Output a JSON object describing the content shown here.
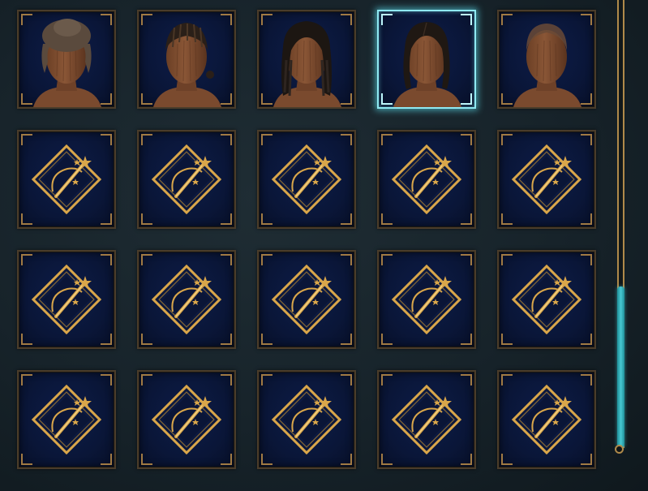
{
  "grid": {
    "columns": 5,
    "selected_index": 3,
    "items": [
      {
        "kind": "hairstyle",
        "icon": "hairstyle-bun-icon",
        "hair": "bun",
        "hair_color": "#5a4a3d"
      },
      {
        "kind": "hairstyle",
        "icon": "hairstyle-cornrows-icon",
        "hair": "cornrows",
        "hair_color": "#2a1f18"
      },
      {
        "kind": "hairstyle",
        "icon": "hairstyle-locs-icon",
        "hair": "locs",
        "hair_color": "#1c1612"
      },
      {
        "kind": "hairstyle",
        "icon": "hairstyle-long-parted-icon",
        "hair": "long",
        "hair_color": "#1f1813"
      },
      {
        "kind": "hairstyle",
        "icon": "hairstyle-shaved-icon",
        "hair": "shaved",
        "hair_color": "#6a4a36"
      },
      {
        "kind": "custom",
        "icon": "magic-wand-icon"
      },
      {
        "kind": "custom",
        "icon": "magic-wand-icon"
      },
      {
        "kind": "custom",
        "icon": "magic-wand-icon"
      },
      {
        "kind": "custom",
        "icon": "magic-wand-icon"
      },
      {
        "kind": "custom",
        "icon": "magic-wand-icon"
      },
      {
        "kind": "custom",
        "icon": "magic-wand-icon"
      },
      {
        "kind": "custom",
        "icon": "magic-wand-icon"
      },
      {
        "kind": "custom",
        "icon": "magic-wand-icon"
      },
      {
        "kind": "custom",
        "icon": "magic-wand-icon"
      },
      {
        "kind": "custom",
        "icon": "magic-wand-icon"
      },
      {
        "kind": "custom",
        "icon": "magic-wand-icon"
      },
      {
        "kind": "custom",
        "icon": "magic-wand-icon"
      },
      {
        "kind": "custom",
        "icon": "magic-wand-icon"
      },
      {
        "kind": "custom",
        "icon": "magic-wand-icon"
      },
      {
        "kind": "custom",
        "icon": "magic-wand-icon"
      }
    ]
  },
  "scrollbar": {
    "position_fraction": 0.64,
    "visible_fraction": 0.36
  },
  "colors": {
    "accent_selected": "#8fe9f2",
    "frame_gold": "#a07a44",
    "icon_gold": "#d9a64a",
    "tile_navy": "#0b1740",
    "skin_wood": "#8a5636"
  }
}
